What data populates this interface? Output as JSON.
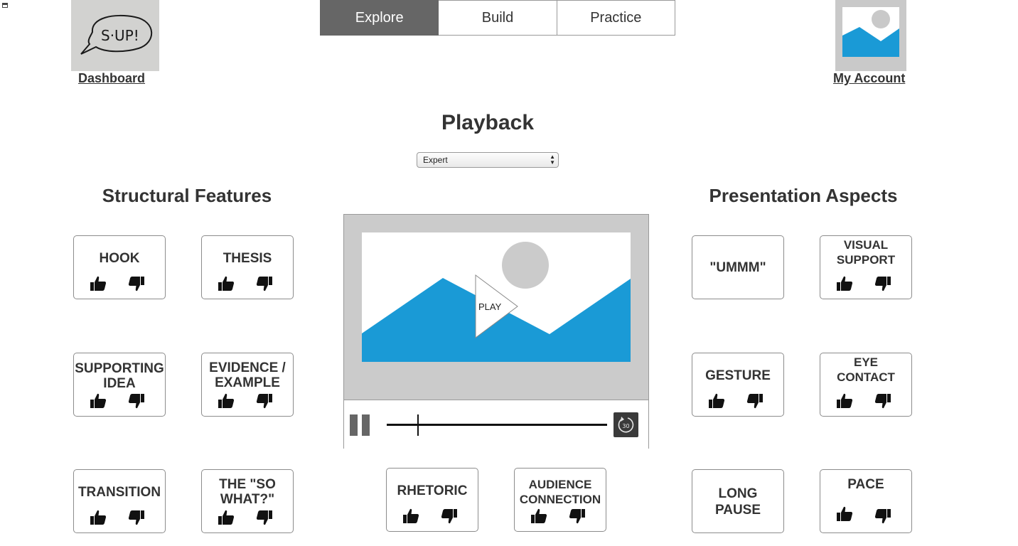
{
  "logo": {
    "text": "S·UP!"
  },
  "nav": {
    "dashboard": "Dashboard",
    "my_account": "My Account"
  },
  "tabs": [
    {
      "label": "Explore",
      "active": true
    },
    {
      "label": "Build",
      "active": false
    },
    {
      "label": "Practice",
      "active": false
    }
  ],
  "page": {
    "title": "Playback"
  },
  "mode_select": {
    "value": "Expert"
  },
  "structural": {
    "title": "Structural Features",
    "items": [
      "HOOK",
      "THESIS",
      "SUPPORTING IDEA",
      "EVIDENCE / EXAMPLE",
      "TRANSITION",
      "THE \"SO WHAT?\""
    ]
  },
  "presentation": {
    "title": "Presentation Aspects",
    "items": [
      "\"UMMM\"",
      "VISUAL SUPPORT",
      "GESTURE",
      "EYE CONTACT",
      "LONG PAUSE",
      "PACE"
    ]
  },
  "bottom_center": {
    "items": [
      "RHETORIC",
      "AUDIENCE CONNECTION"
    ]
  },
  "player": {
    "play_label": "PLAY",
    "replay_seconds": "30"
  },
  "colors": {
    "accent_blue": "#1a9ad6",
    "tab_active": "#666666",
    "placeholder_gray": "#cbcbcb"
  },
  "icons": {
    "up": "thumbs-up-icon",
    "down": "thumbs-down-icon"
  }
}
